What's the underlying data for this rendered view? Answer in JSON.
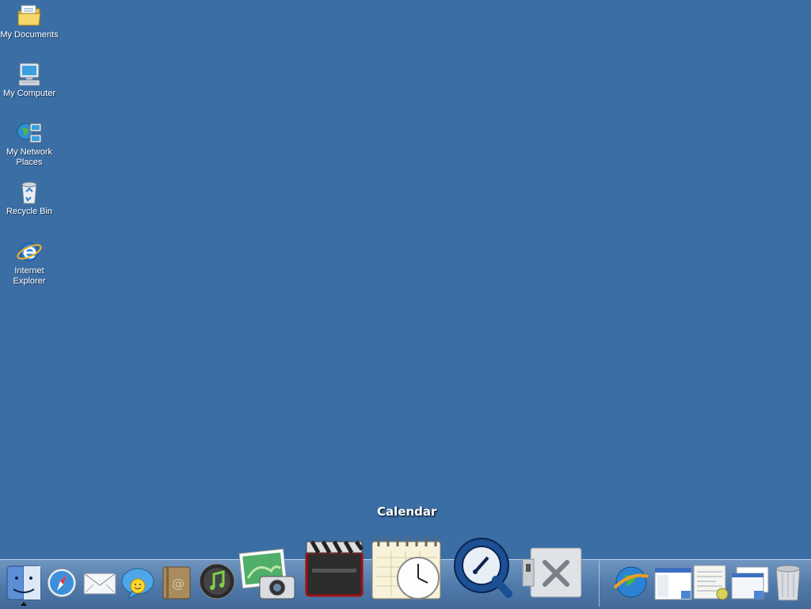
{
  "desktop": {
    "background_color": "#3a6ea5",
    "icons": [
      {
        "label": "My Documents",
        "icon": "my-documents-icon"
      },
      {
        "label": "My Computer",
        "icon": "my-computer-icon"
      },
      {
        "label": "My Network Places",
        "icon": "my-network-places-icon"
      },
      {
        "label": "Recycle Bin",
        "icon": "recycle-bin-icon"
      },
      {
        "label": "Internet Explorer",
        "icon": "internet-explorer-icon"
      }
    ]
  },
  "dock": {
    "tooltip": "Calendar",
    "items": [
      {
        "icon": "finder-icon"
      },
      {
        "icon": "safari-icon"
      },
      {
        "icon": "mail-icon"
      },
      {
        "icon": "ichat-icon"
      },
      {
        "icon": "address-book-icon"
      },
      {
        "icon": "itunes-icon"
      },
      {
        "icon": "iphoto-icon"
      },
      {
        "icon": "clapper-board-icon"
      },
      {
        "icon": "calendar-icon"
      },
      {
        "icon": "quicktime-icon"
      },
      {
        "icon": "system-tools-icon"
      },
      {
        "icon": "network-globe-icon"
      },
      {
        "icon": "window-thumbnail-icon"
      },
      {
        "icon": "document-thumbnail-icon"
      },
      {
        "icon": "window-stack-thumbnail-icon"
      },
      {
        "icon": "trash-icon"
      }
    ]
  }
}
